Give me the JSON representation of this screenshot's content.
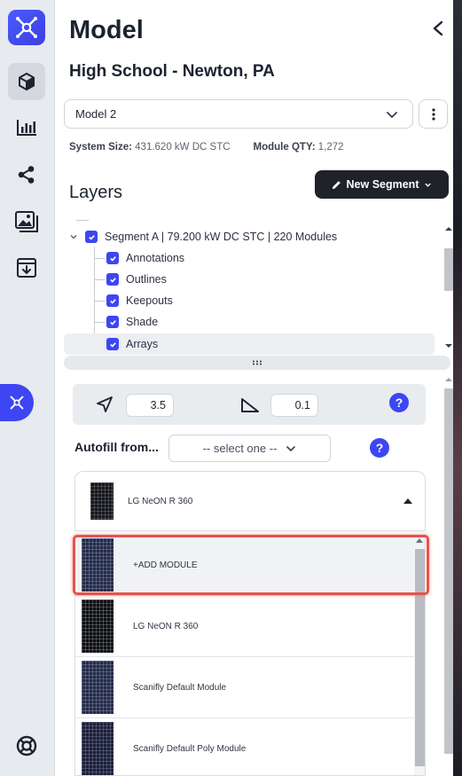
{
  "rail": {
    "logo": "scanifly-logo-icon",
    "items": [
      {
        "name": "model-cube-icon",
        "active": true
      },
      {
        "name": "bar-chart-icon",
        "active": false
      },
      {
        "name": "share-icon",
        "active": false
      },
      {
        "name": "image-gallery-icon",
        "active": false
      },
      {
        "name": "download-box-icon",
        "active": false
      }
    ],
    "flag_icon": "scanifly-logo-icon",
    "help_icon": "lifebuoy-icon"
  },
  "header": {
    "title": "Model",
    "project_name": "High School - Newton, PA"
  },
  "model_select": {
    "value": "Model 2"
  },
  "specs": {
    "system_size_label": "System Size:",
    "system_size_value": "431.620 kW DC STC",
    "module_qty_label": "Module QTY:",
    "module_qty_value": "1,272"
  },
  "layers": {
    "title": "Layers",
    "new_segment_label": "New Segment",
    "segment_label": "Segment A | 79.200 kW DC STC | 220 Modules",
    "children": [
      "Annotations",
      "Outlines",
      "Keepouts",
      "Shade",
      "Arrays"
    ]
  },
  "tilt": {
    "azimuth_value": "3.5",
    "tilt_value": "0.1"
  },
  "autofill": {
    "label": "Autofill from...",
    "placeholder": "-- select one --"
  },
  "module_select": {
    "selected": "LG NeON R 360"
  },
  "module_options": [
    {
      "label": "+ADD MODULE",
      "thumb": "blue"
    },
    {
      "label": "LG NeON R 360",
      "thumb": "black"
    },
    {
      "label": "Scanifly Default Module",
      "thumb": "blue"
    },
    {
      "label": "Scanifly Default Poly Module",
      "thumb": "navy"
    }
  ],
  "colors": {
    "accent": "#3d46f2",
    "highlight": "#e5534b",
    "dark_button": "#1f2229"
  }
}
